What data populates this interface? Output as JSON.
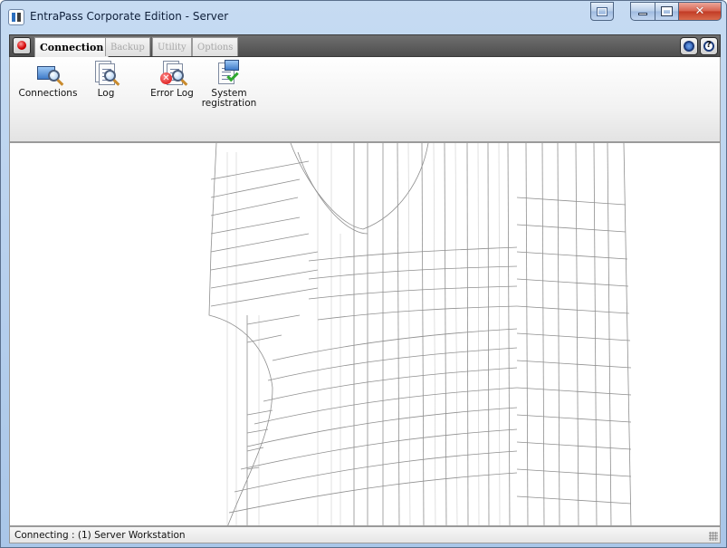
{
  "window": {
    "title": "EntraPass Corporate Edition - Server"
  },
  "ribbon": {
    "tabs": [
      {
        "label": "Connection",
        "active": true
      },
      {
        "label": "Backup",
        "active": false
      },
      {
        "label": "Utility",
        "active": false
      },
      {
        "label": "Options",
        "active": false
      }
    ],
    "buttons": [
      {
        "label": "Connections",
        "icon": "connections-icon"
      },
      {
        "label": "Log",
        "icon": "log-icon"
      },
      {
        "label": "Error Log",
        "icon": "error-log-icon"
      },
      {
        "label": "System registration",
        "icon": "system-registration-icon"
      }
    ]
  },
  "statusbar": {
    "text": "Connecting : (1)  Server Workstation"
  },
  "colors": {
    "title_bar": "#b9d1ee",
    "close_button": "#c9452e",
    "tab_strip": "#5e5e5e",
    "content_background": "#ffffff"
  }
}
